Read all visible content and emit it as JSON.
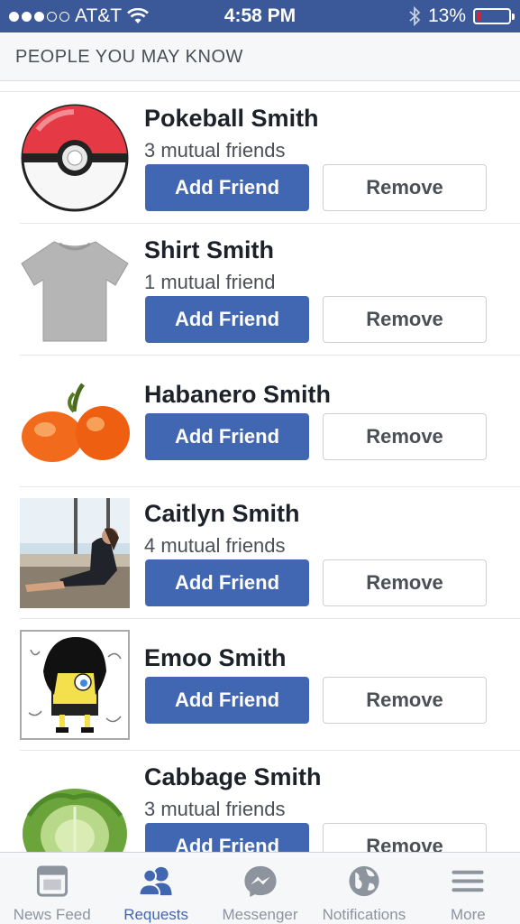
{
  "status_bar": {
    "carrier": "AT&T",
    "time": "4:58 PM",
    "battery": "13%",
    "battery_level": 0.13,
    "battery_color": "#e0202a"
  },
  "section": {
    "title": "PEOPLE YOU MAY KNOW"
  },
  "people": [
    {
      "name": "Pokeball Smith",
      "mutual": "3 mutual friends",
      "avatar": "pokeball-image"
    },
    {
      "name": "Shirt Smith",
      "mutual": "1 mutual friend",
      "avatar": "gray-tshirt-image"
    },
    {
      "name": "Habanero Smith",
      "mutual": "",
      "avatar": "habanero-peppers-image"
    },
    {
      "name": "Caitlyn Smith",
      "mutual": "4 mutual friends",
      "avatar": "person-photo"
    },
    {
      "name": "Emoo Smith",
      "mutual": "",
      "avatar": "emo-sponge-drawing"
    },
    {
      "name": "Cabbage Smith",
      "mutual": "3 mutual friends",
      "avatar": "cabbage-image"
    }
  ],
  "buttons": {
    "add": "Add Friend",
    "remove": "Remove"
  },
  "tabs": [
    {
      "label": "News Feed",
      "icon": "news-feed-icon",
      "active": false
    },
    {
      "label": "Requests",
      "icon": "requests-icon",
      "active": true
    },
    {
      "label": "Messenger",
      "icon": "messenger-icon",
      "active": false
    },
    {
      "label": "Notifications",
      "icon": "globe-icon",
      "active": false
    },
    {
      "label": "More",
      "icon": "menu-icon",
      "active": false
    }
  ],
  "colors": {
    "brand": "#3b5999",
    "button": "#4267b2"
  }
}
